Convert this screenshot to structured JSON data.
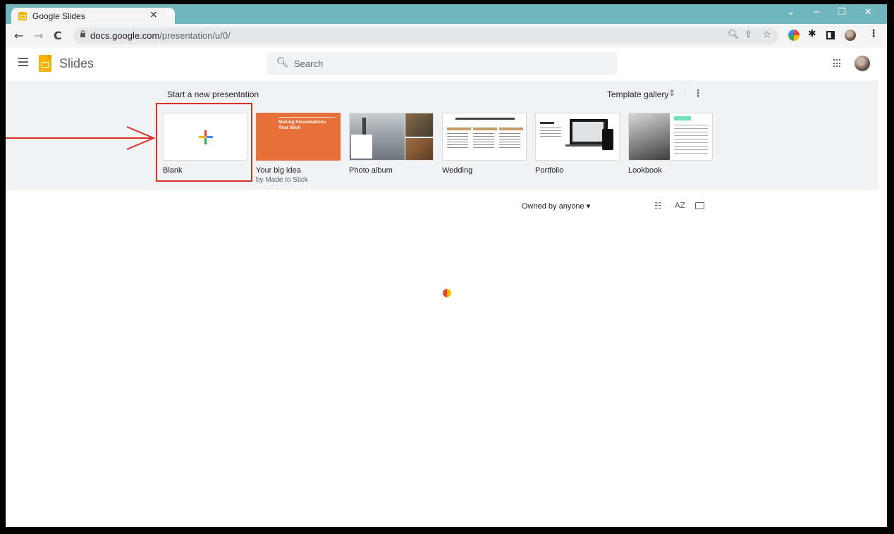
{
  "browser": {
    "tab_title": "Google Slides",
    "tab_close": "×",
    "new_tab": "+",
    "window_controls": [
      "⌄",
      "−",
      "❐",
      "✕"
    ],
    "nav": {
      "back": "←",
      "forward": "→",
      "reload": "C"
    },
    "url_host": "docs.google.com",
    "url_path": "/presentation/u/0/",
    "omnibox_icons": [
      "zoom-icon",
      "share-icon",
      "star-icon"
    ],
    "toolbar_icons": [
      "extension-colorful-icon",
      "puzzle-icon",
      "sidepanel-icon",
      "profile-avatar",
      "kebab-menu-icon"
    ]
  },
  "header": {
    "app_name": "Slides",
    "search_placeholder": "Search"
  },
  "templates": {
    "section_title": "Start a new presentation",
    "gallery_label": "Template gallery",
    "gallery_arrows": "⌃⌄",
    "more": "⋮",
    "items": [
      {
        "label": "Blank",
        "sub": ""
      },
      {
        "label": "Your big idea",
        "sub": "by Made to Stick",
        "thumb_title": "Making Presentations That Stick"
      },
      {
        "label": "Photo album",
        "sub": ""
      },
      {
        "label": "Wedding",
        "sub": ""
      },
      {
        "label": "Portfolio",
        "sub": ""
      },
      {
        "label": "Lookbook",
        "sub": ""
      }
    ]
  },
  "list": {
    "owned_filter": "Owned by anyone ▾",
    "list_view": "☷",
    "sort": "AZ",
    "folder": "🗀"
  },
  "colors": {
    "accent_red": "#d93025",
    "tab_strip": "#6fb7bd",
    "slides_yellow": "#f5b400"
  }
}
